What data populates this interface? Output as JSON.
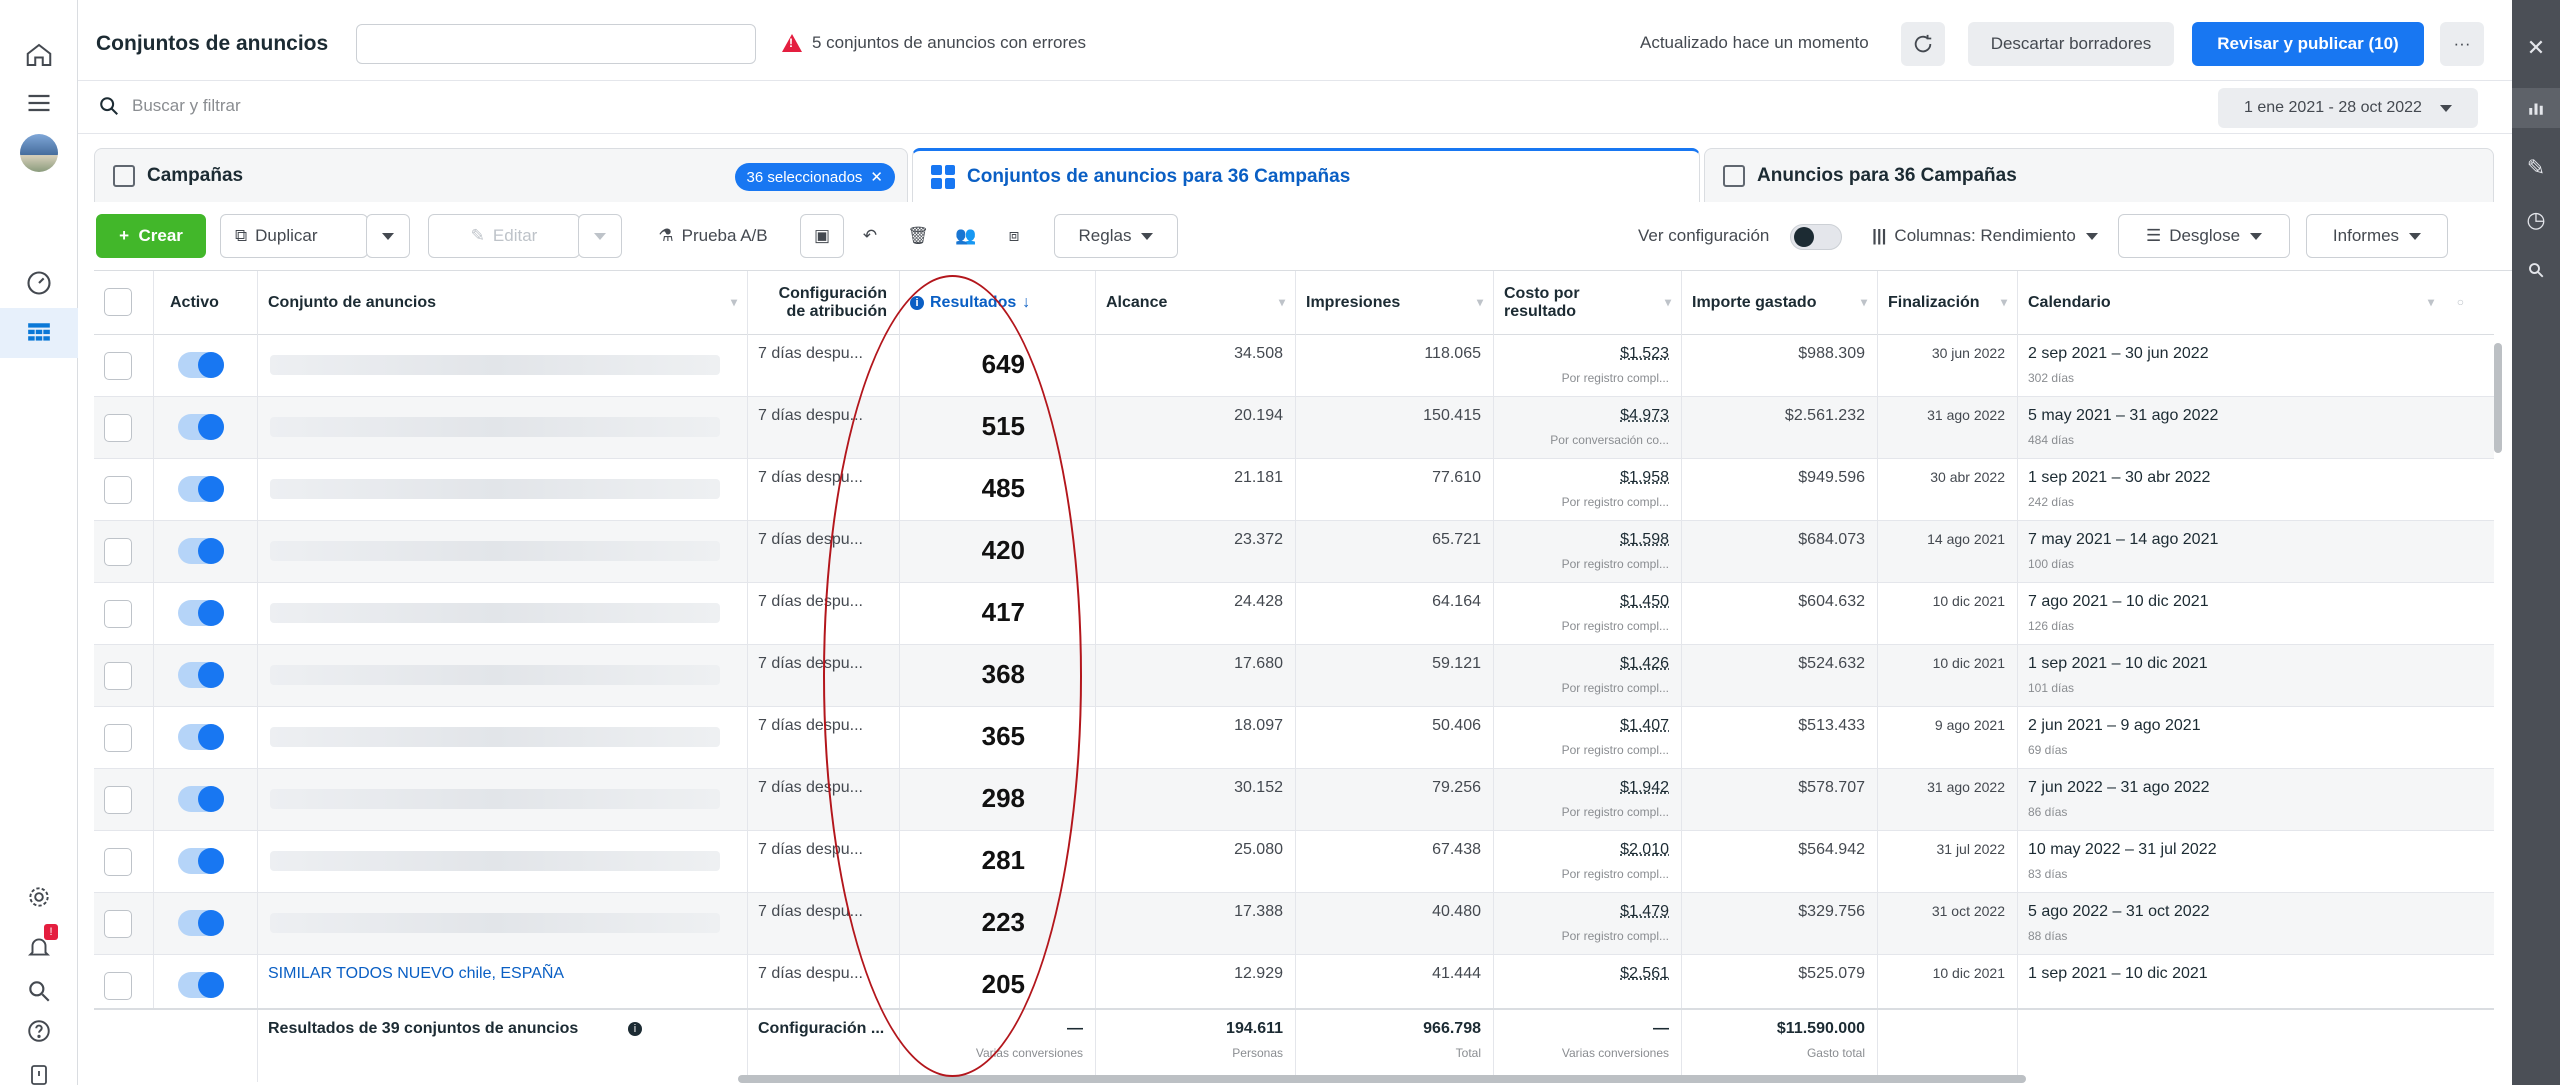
{
  "topbar": {
    "title": "Conjuntos de anuncios",
    "errors": "5 conjuntos de anuncios con errores",
    "updated": "Actualizado hace un momento",
    "discard": "Descartar borradores",
    "review": "Revisar y publicar (10)",
    "more": "···"
  },
  "search": {
    "placeholder": "Buscar y filtrar",
    "daterange": "1 ene 2021 - 28 oct 2022"
  },
  "tabs": {
    "campaigns": "Campañas",
    "selected": "36 seleccionados",
    "adsets": "Conjuntos de anuncios para 36 Campañas",
    "ads": "Anuncios para 36 Campañas"
  },
  "toolbar": {
    "create": "Crear",
    "duplicate": "Duplicar",
    "edit": "Editar",
    "abtest": "Prueba A/B",
    "rules": "Reglas",
    "view_settings": "Ver configuración",
    "columns": "Columnas: Rendimiento",
    "breakdown": "Desglose",
    "reports": "Informes"
  },
  "columns": {
    "active": "Activo",
    "adset": "Conjunto de anuncios",
    "attribution": "Configuración de atribución",
    "results": "Resultados",
    "reach": "Alcance",
    "impressions": "Impresiones",
    "cost": "Costo por resultado",
    "spent": "Importe gastado",
    "end": "Finalización",
    "schedule": "Calendario"
  },
  "rows": [
    {
      "name": "",
      "attribution": "7 días despu...",
      "results": "649",
      "reach": "34.508",
      "impressions": "118.065",
      "cost": "$1.523",
      "cost_sub": "Por registro compl...",
      "spent": "$988.309",
      "end": "30 jun 2022",
      "schedule": "2 sep 2021 – 30 jun 2022",
      "days": "302 días"
    },
    {
      "name": "",
      "attribution": "7 días despu...",
      "results": "515",
      "reach": "20.194",
      "impressions": "150.415",
      "cost": "$4.973",
      "cost_sub": "Por conversación co...",
      "spent": "$2.561.232",
      "end": "31 ago 2022",
      "schedule": "5 may 2021 – 31 ago 2022",
      "days": "484 días"
    },
    {
      "name": "",
      "attribution": "7 días despu...",
      "results": "485",
      "reach": "21.181",
      "impressions": "77.610",
      "cost": "$1.958",
      "cost_sub": "Por registro compl...",
      "spent": "$949.596",
      "end": "30 abr 2022",
      "schedule": "1 sep 2021 – 30 abr 2022",
      "days": "242 días"
    },
    {
      "name": "",
      "attribution": "7 días despu...",
      "results": "420",
      "reach": "23.372",
      "impressions": "65.721",
      "cost": "$1.598",
      "cost_sub": "Por registro compl...",
      "spent": "$684.073",
      "end": "14 ago 2021",
      "schedule": "7 may 2021 – 14 ago 2021",
      "days": "100 días"
    },
    {
      "name": "",
      "attribution": "7 días despu...",
      "results": "417",
      "reach": "24.428",
      "impressions": "64.164",
      "cost": "$1.450",
      "cost_sub": "Por registro compl...",
      "spent": "$604.632",
      "end": "10 dic 2021",
      "schedule": "7 ago 2021 – 10 dic 2021",
      "days": "126 días"
    },
    {
      "name": "",
      "attribution": "7 días despu...",
      "results": "368",
      "reach": "17.680",
      "impressions": "59.121",
      "cost": "$1.426",
      "cost_sub": "Por registro compl...",
      "spent": "$524.632",
      "end": "10 dic 2021",
      "schedule": "1 sep 2021 – 10 dic 2021",
      "days": "101 días"
    },
    {
      "name": "",
      "attribution": "7 días despu...",
      "results": "365",
      "reach": "18.097",
      "impressions": "50.406",
      "cost": "$1.407",
      "cost_sub": "Por registro compl...",
      "spent": "$513.433",
      "end": "9 ago 2021",
      "schedule": "2 jun 2021 – 9 ago 2021",
      "days": "69 días"
    },
    {
      "name": "",
      "attribution": "7 días despu...",
      "results": "298",
      "reach": "30.152",
      "impressions": "79.256",
      "cost": "$1.942",
      "cost_sub": "Por registro compl...",
      "spent": "$578.707",
      "end": "31 ago 2022",
      "schedule": "7 jun 2022 – 31 ago 2022",
      "days": "86 días"
    },
    {
      "name": "",
      "attribution": "7 días despu...",
      "results": "281",
      "reach": "25.080",
      "impressions": "67.438",
      "cost": "$2.010",
      "cost_sub": "Por registro compl...",
      "spent": "$564.942",
      "end": "31 jul 2022",
      "schedule": "10 may 2022 – 31 jul 2022",
      "days": "83 días"
    },
    {
      "name": "",
      "attribution": "7 días despu...",
      "results": "223",
      "reach": "17.388",
      "impressions": "40.480",
      "cost": "$1.479",
      "cost_sub": "Por registro compl...",
      "spent": "$329.756",
      "end": "31 oct 2022",
      "schedule": "5 ago 2022 – 31 oct 2022",
      "days": "88 días"
    },
    {
      "name": "SIMILAR TODOS NUEVO chile, ESPAÑA",
      "attribution": "7 días despu...",
      "results": "205",
      "reach": "12.929",
      "impressions": "41.444",
      "cost": "$2.561",
      "cost_sub": "",
      "spent": "$525.079",
      "end": "10 dic 2021",
      "schedule": "1 sep 2021 – 10 dic 2021",
      "days": ""
    }
  ],
  "summary": {
    "label": "Resultados de 39 conjuntos de anuncios",
    "attribution": "Configuración ...",
    "results": "—",
    "results_sub": "Varias conversiones",
    "reach": "194.611",
    "reach_sub": "Personas",
    "impressions": "966.798",
    "impressions_sub": "Total",
    "cost": "—",
    "cost_sub": "Varias conversiones",
    "spent": "$11.590.000",
    "spent_sub": "Gasto total"
  }
}
